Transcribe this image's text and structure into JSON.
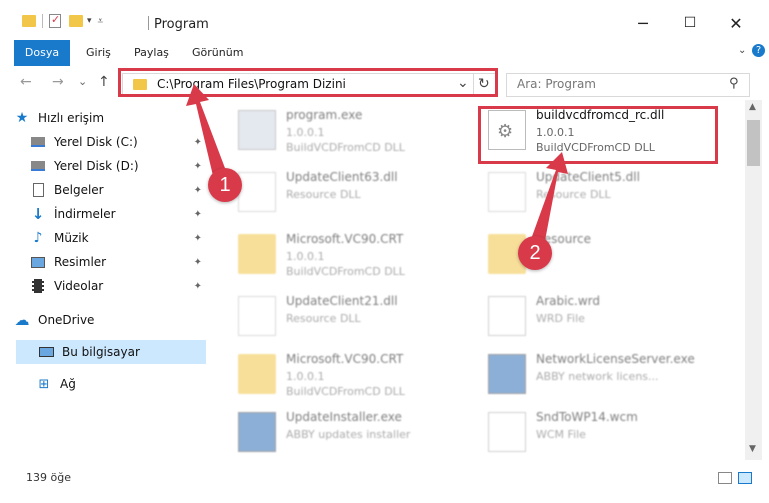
{
  "window": {
    "title": "Program",
    "controls": {
      "minimize": "─",
      "maximize": "☐",
      "close": "✕"
    }
  },
  "ribbon": {
    "tabs": [
      "Dosya",
      "Giriş",
      "Paylaş",
      "Görünüm"
    ],
    "accent": "#1979ca"
  },
  "nav": {
    "back": "←",
    "forward": "→",
    "recent": "⌄",
    "up": "↑",
    "address": "C:\\Program Files\\Program Dizini",
    "refresh": "↻",
    "search_placeholder": "Ara: Program"
  },
  "sidebar": {
    "items": [
      {
        "label": "Hızlı erişim",
        "icon": "star-icon",
        "pinned": false
      },
      {
        "label": "Yerel Disk (C:)",
        "icon": "drive-icon",
        "pinned": true
      },
      {
        "label": "Yerel Disk (D:)",
        "icon": "drive-icon",
        "pinned": true
      },
      {
        "label": "Belgeler",
        "icon": "document-icon",
        "pinned": true
      },
      {
        "label": "İndirmeler",
        "icon": "download-icon",
        "pinned": true
      },
      {
        "label": "Müzik",
        "icon": "music-icon",
        "pinned": true
      },
      {
        "label": "Resimler",
        "icon": "picture-icon",
        "pinned": true
      },
      {
        "label": "Videolar",
        "icon": "video-icon",
        "pinned": true
      },
      {
        "label": "OneDrive",
        "icon": "cloud-icon",
        "pinned": false
      },
      {
        "label": "Bu bilgisayar",
        "icon": "computer-icon",
        "pinned": false
      },
      {
        "label": "Ağ",
        "icon": "network-icon",
        "pinned": false
      }
    ],
    "pin_glyph": "📌"
  },
  "files": [
    {
      "name": "program.exe",
      "line2": "1.0.0.1",
      "line3": "BuildVCDFromCD DLL",
      "kind": "exe"
    },
    {
      "name": "buildvcdfromcd_rc.dll",
      "line2": "1.0.0.1",
      "line3": "BuildVCDFromCD DLL",
      "kind": "dll"
    },
    {
      "name": "UpdateClient63.dll",
      "line2": "Resource DLL",
      "line3": "",
      "kind": "dll"
    },
    {
      "name": "UpdateClient5.dll",
      "line2": "Resource DLL",
      "line3": "",
      "kind": "dll"
    },
    {
      "name": "Microsoft.VC90.CRT",
      "line2": "1.0.0.1",
      "line3": "BuildVCDFromCD DLL",
      "kind": "folder"
    },
    {
      "name": "Resource",
      "line2": "",
      "line3": "",
      "kind": "folder"
    },
    {
      "name": "UpdateClient21.dll",
      "line2": "Resource DLL",
      "line3": "",
      "kind": "dll"
    },
    {
      "name": "Arabic.wrd",
      "line2": "WRD File",
      "line3": "",
      "kind": "file"
    },
    {
      "name": "Microsoft.VC90.CRT",
      "line2": "1.0.0.1",
      "line3": "BuildVCDFromCD DLL",
      "kind": "folder"
    },
    {
      "name": "NetworkLicenseServer.exe",
      "line2": "ABBY network licens...",
      "line3": "",
      "kind": "app"
    },
    {
      "name": "UpdateInstaller.exe",
      "line2": "ABBY updates installer",
      "line3": "",
      "kind": "app"
    },
    {
      "name": "SndToWP14.wcm",
      "line2": "WCM File",
      "line3": "",
      "kind": "file"
    }
  ],
  "status": {
    "count": "139 öğe"
  },
  "annotations": {
    "callout1": "1",
    "callout2": "2",
    "color": "#d93a4a"
  }
}
